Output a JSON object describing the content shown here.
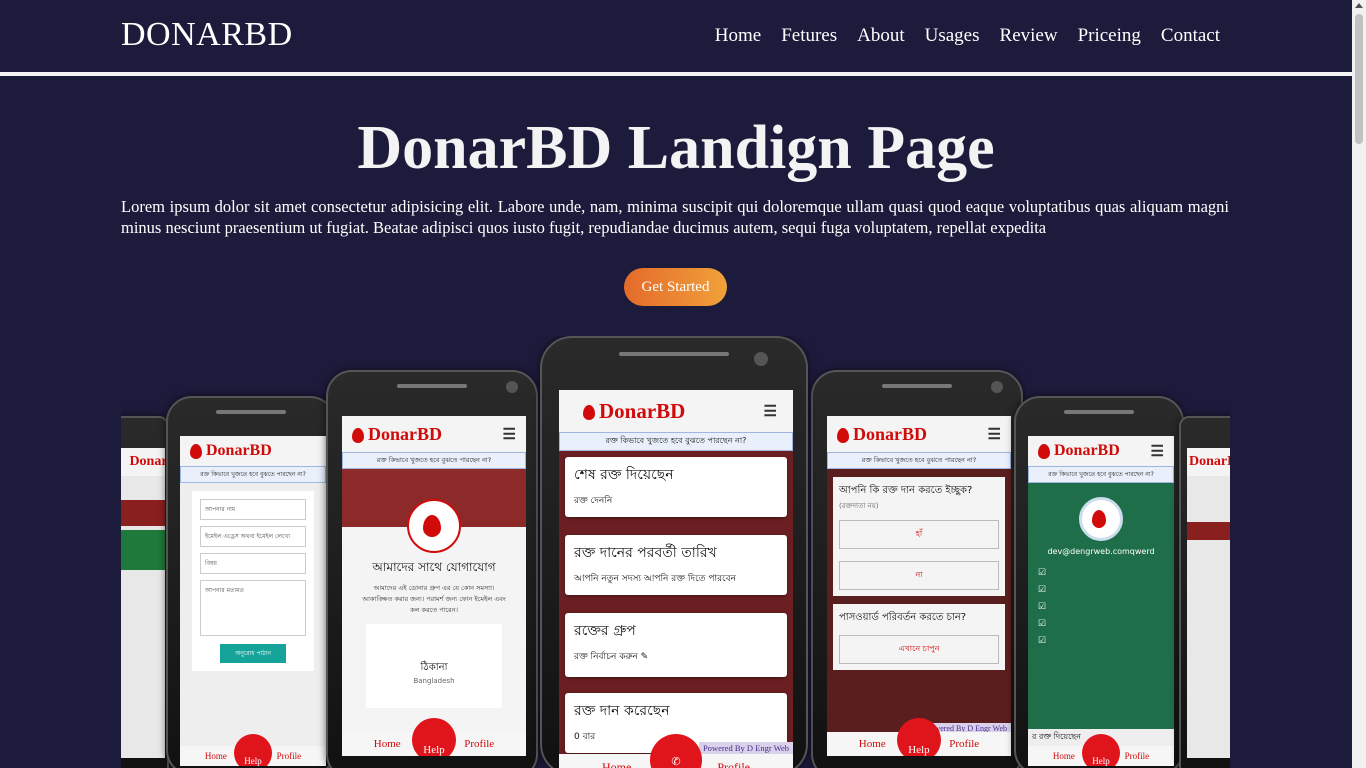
{
  "brand": "DONARBD",
  "nav": [
    "Home",
    "Fetures",
    "About",
    "Usages",
    "Review",
    "Priceing",
    "Contact"
  ],
  "hero": {
    "title": "DonarBD Landign Page",
    "text": "Lorem ipsum dolor sit amet consectetur adipisicing elit. Labore unde, nam, minima suscipit qui doloremque ullam quasi quod eaque voluptatibus quas aliquam magni minus nesciunt praesentium ut fugiat. Beatae adipisci quos iusto fugit, repudiandae ducimus autem, sequi fuga voluptatem, repellat expedita",
    "cta": "Get Started"
  },
  "app": {
    "name": "DonarBD",
    "notice": "রক্ত কিভাবে খুজতে হবে বুঝতে পারছেন না?",
    "bottom_home": "Home",
    "bottom_profile": "Profile",
    "help": "Help",
    "powered": "Powered By D Engr Web",
    "center_cards": [
      {
        "h": "শেষ রক্ত দিয়েছেন",
        "s": "রক্ত দেননি"
      },
      {
        "h": "রক্ত দানের পরবর্তী তারিখ",
        "s": "আপনি নতুন সদস্য আপনি রক্ত দিতে পারবেন"
      },
      {
        "h": "রক্তের গ্রুপ",
        "s": "রক্ত নির্বাচন করুন"
      },
      {
        "h": "রক্ত দান করেছেন",
        "s": "0 বার"
      }
    ],
    "contact_title": "আমাদের সাথে যোগাযোগ",
    "contact_text": "আমাদের এই ডোনার গ্রুপ এর যে কোন সমস্যা। আকাঙ্ক্ষিত করার জন্য। পরামর্শ জন্য ফোন ইমেইল এবং কল করতে পারেন।",
    "address_label": "ঠিকানা",
    "address_value": "Bangladesh",
    "form_placeholders": [
      "আপনার নাম",
      "ইমেইল এড্রেস অথবা ইমেইল লেখো",
      "বিষয়",
      "আপনার মতামত"
    ],
    "form_submit": "অনুরোধ পাঠান",
    "right_q1": "আপনি কি রক্ত দান করতে ইচ্ছুক?",
    "right_q1_sub": "(রক্তদাতা নয়)",
    "right_yes": "হাঁ",
    "right_no": "না",
    "right_q2": "পাসওয়ার্ড পরিবর্তন করতে চান?",
    "right_q2_btn": "এখানে চাপুন",
    "profile_email": "dev@dengrweb.comqwerd",
    "profile_footer": "র রক্ত দিয়েছেন"
  }
}
